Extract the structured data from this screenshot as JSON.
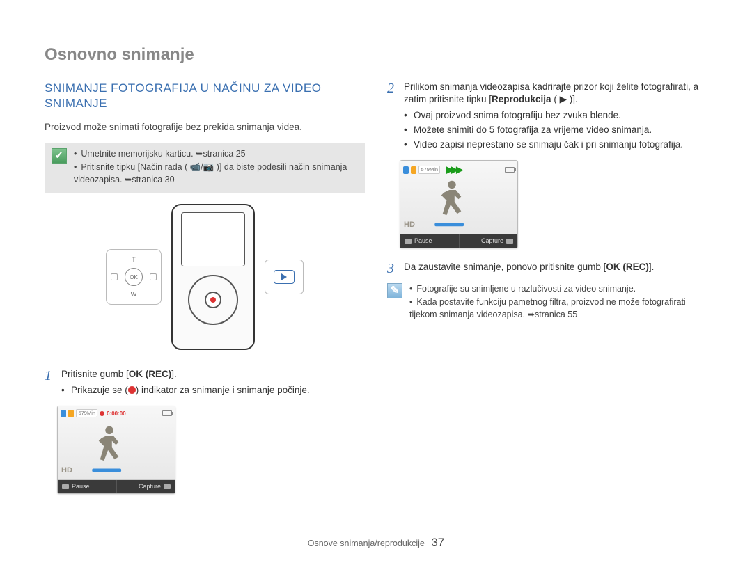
{
  "chapter_title": "Osnovno snimanje",
  "section_title": "SNIMANJE FOTOGRAFIJA U NAČINU ZA VIDEO SNIMANJE",
  "intro": "Proizvod može snimati fotografije bez prekida snimanja videa.",
  "note1": {
    "items": [
      "Umetnite memorijsku karticu. ➥stranica 25",
      "Pritisnite tipku [Način rada ( 📹/📷 )] da biste podesili način snimanja videozapisa. ➥stranica 30"
    ]
  },
  "dpad": {
    "t": "T",
    "w": "W",
    "ok": "OK"
  },
  "step1": {
    "num": "1",
    "text_a": "Pritisnite gumb [",
    "text_b": "OK (REC)",
    "text_c": "].",
    "bullet_a": "Prikazuje se (",
    "bullet_b": ") indikator za snimanje i snimanje počinje."
  },
  "step2": {
    "num": "2",
    "line1_a": "Prilikom snimanja videozapisa kadrirajte prizor koji želite fotografirati, a zatim pritisnite tipku [",
    "line1_b": "Reprodukcija",
    "line1_c": " ( ▶ )].",
    "bullets": [
      "Ovaj proizvod snima fotografiju bez zvuka blende.",
      "Možete snimiti do 5 fotografija za vrijeme video snimanja.",
      "Video zapisi neprestano se snimaju čak i pri snimanju fotografija."
    ]
  },
  "step3": {
    "num": "3",
    "text_a": "Da zaustavite snimanje, ponovo pritisnite gumb [",
    "text_b": "OK (REC)",
    "text_c": "]."
  },
  "note2": {
    "items": [
      "Fotografije su snimljene u razlučivosti za video snimanje.",
      "Kada postavite funkciju pametnog filtra, proizvod ne može fotografirati tijekom snimanja videozapisa. ➥stranica 55"
    ]
  },
  "screen": {
    "badge579": "579Min",
    "rec_time": "0:00:00",
    "hd": "HD",
    "pause": "Pause",
    "capture": "Capture"
  },
  "footer": {
    "section": "Osnove snimanja/reprodukcije",
    "page": "37"
  }
}
